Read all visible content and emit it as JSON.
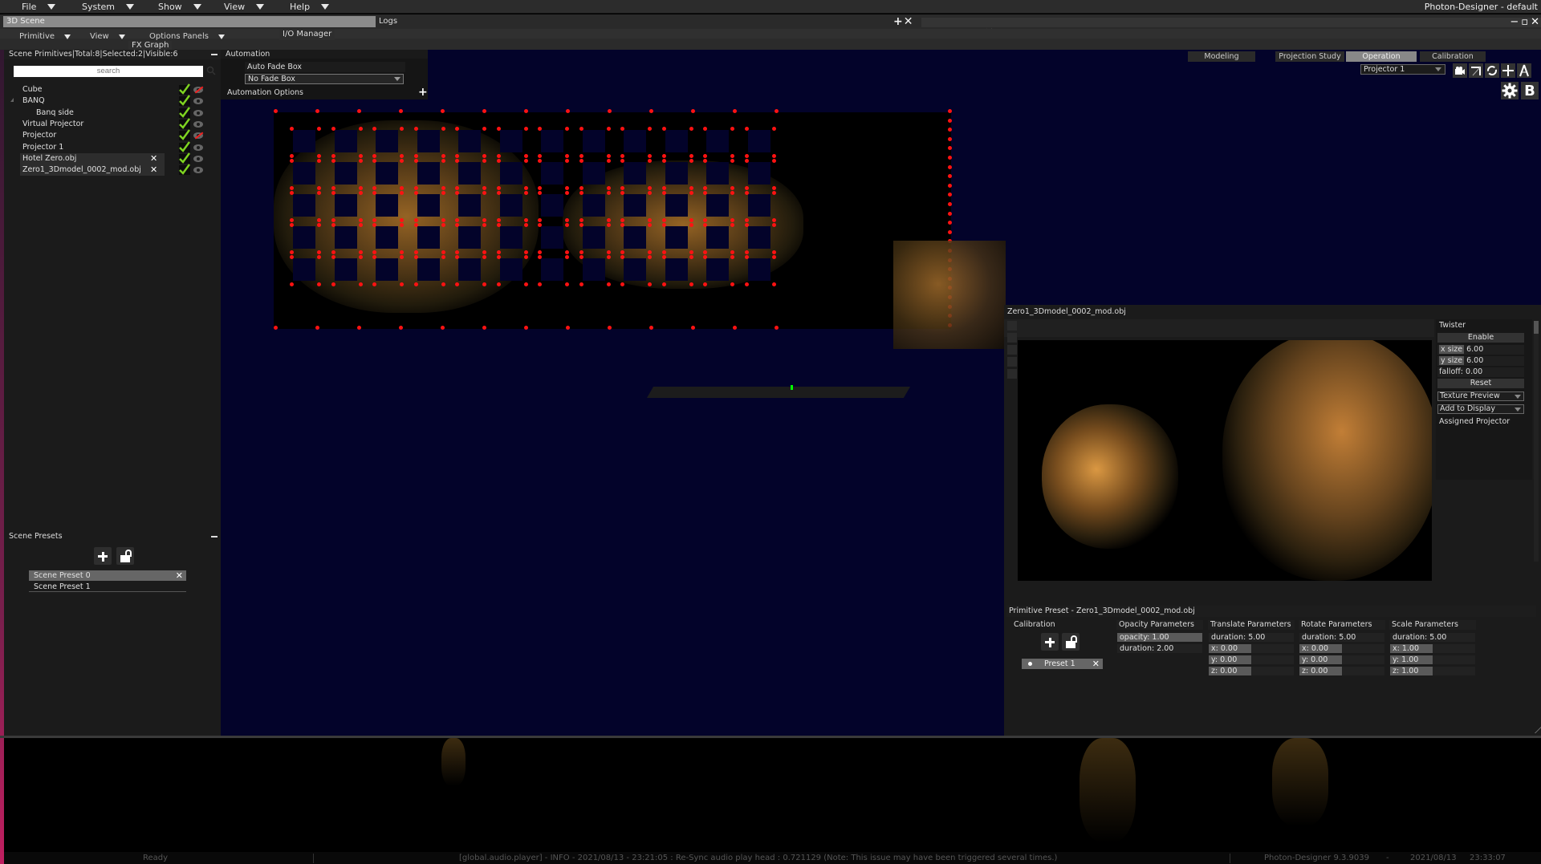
{
  "app": {
    "title": "Photon-Designer - default",
    "window_controls": [
      "minimize",
      "maximize",
      "close"
    ]
  },
  "menubar": [
    {
      "label": "File"
    },
    {
      "label": "System"
    },
    {
      "label": "Show"
    },
    {
      "label": "View"
    },
    {
      "label": "Help"
    }
  ],
  "tabs": {
    "scene_tab": "3D Scene",
    "logs_tab": "Logs",
    "io_manager": "I/O Manager",
    "fx_graph": "FX Graph",
    "add_close": "+✕"
  },
  "scene_submenu": [
    {
      "label": "Primitive"
    },
    {
      "label": "View"
    },
    {
      "label": "Options Panels"
    }
  ],
  "scene_primitives": {
    "header": "Scene Primitives|Total:8|Selected:2|Visible:6",
    "search_placeholder": "search",
    "items": [
      {
        "label": "Cube",
        "indent": 0,
        "checked": true,
        "visible": false,
        "selected": false
      },
      {
        "label": "BANQ",
        "indent": 0,
        "checked": true,
        "visible": true,
        "selected": false,
        "expander": true
      },
      {
        "label": "Banq side",
        "indent": 1,
        "checked": true,
        "visible": true,
        "selected": false
      },
      {
        "label": "Virtual Projector",
        "indent": 0,
        "checked": true,
        "visible": true,
        "selected": false
      },
      {
        "label": "Projector",
        "indent": 0,
        "checked": true,
        "visible": false,
        "selected": false
      },
      {
        "label": "Projector 1",
        "indent": 0,
        "checked": true,
        "visible": true,
        "selected": false
      },
      {
        "label": "Hotel Zero.obj",
        "indent": 0,
        "checked": true,
        "visible": true,
        "selected": true
      },
      {
        "label": "Zero1_3Dmodel_0002_mod.obj",
        "indent": 0,
        "checked": true,
        "visible": true,
        "selected": true
      }
    ]
  },
  "scene_presets": {
    "header": "Scene Presets",
    "items": [
      {
        "label": "Scene Preset 0",
        "active": true
      },
      {
        "label": "Scene Preset 1",
        "active": false
      }
    ]
  },
  "automation": {
    "header": "Automation",
    "auto_fade_label": "Auto Fade Box",
    "fade_select_value": "No Fade Box",
    "options_label": "Automation Options"
  },
  "viewport": {
    "mode_tabs": [
      {
        "label": "Modeling",
        "active": false
      },
      {
        "label": "Projection Study",
        "active": false
      },
      {
        "label": "Operation",
        "active": true
      },
      {
        "label": "Calibration",
        "active": false
      }
    ],
    "projector_select": "Projector 1",
    "tools": [
      "camera-icon",
      "corner-icon",
      "rotate-icon",
      "move-icon",
      "compass-icon",
      "gear-icon",
      "bold-b-icon"
    ],
    "tool_b_label": "B"
  },
  "texture_panel": {
    "title": "Zero1_3Dmodel_0002_mod.obj",
    "twister": {
      "header": "Twister",
      "enable_label": "Enable",
      "x_size_label": "x size",
      "x_size_value": "6.00",
      "y_size_label": "y size",
      "y_size_value": "6.00",
      "falloff": "falloff: 0.00",
      "reset_label": "Reset",
      "texture_preview": "Texture Preview",
      "add_to_display": "Add to Display",
      "assigned_projector": "Assigned Projector"
    }
  },
  "primitive_preset": {
    "title": "Primitive Preset - Zero1_3Dmodel_0002_mod.obj",
    "calibration_label": "Calibration",
    "preset_item": "Preset 1",
    "opacity": {
      "header": "Opacity Parameters",
      "opacity": "opacity: 1.00",
      "duration": "duration: 2.00"
    },
    "translate": {
      "header": "Translate Parameters",
      "duration": "duration: 5.00",
      "x": "x: 0.00",
      "y": "y: 0.00",
      "z": "z: 0.00"
    },
    "rotate": {
      "header": "Rotate Parameters",
      "duration": "duration: 5.00",
      "x": "x: 0.00",
      "y": "y: 0.00",
      "z": "z: 0.00"
    },
    "scale": {
      "header": "Scale Parameters",
      "duration": "duration: 5.00",
      "x": "x: 1.00",
      "y": "y: 1.00",
      "z": "z: 1.00"
    }
  },
  "statusbar": {
    "state": "Ready",
    "message": "[global.audio.player] - INFO - 2021/08/13 - 23:21:05 : Re-Sync audio play head : 0.721129 (Note: This issue may have been triggered several times.)",
    "version": "Photon-Designer 9.3.9039",
    "date": "2021/08/13",
    "time": "23:33:07",
    "sep": "-"
  },
  "colors": {
    "viewport_bg": "#03032a",
    "calibration_point": "#ff1212",
    "check_green": "#7ed321",
    "active_tab": "#888888"
  }
}
